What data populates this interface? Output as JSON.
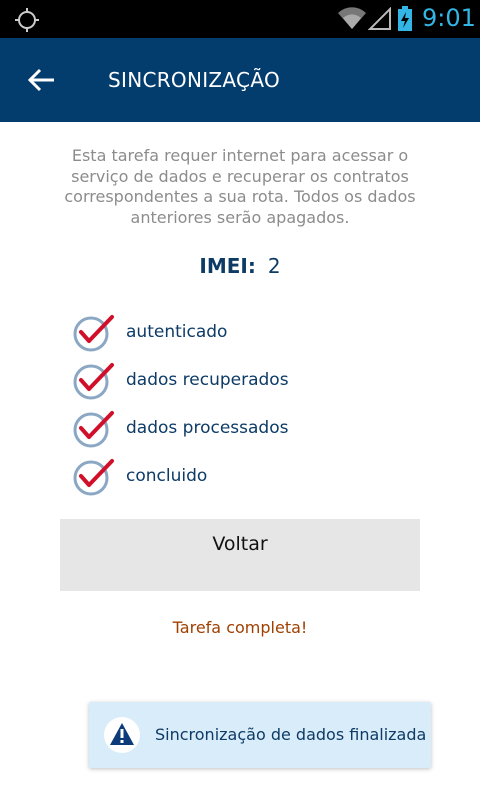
{
  "status_bar": {
    "time": "9:01",
    "icons": [
      "gps-icon",
      "wifi-icon",
      "signal-icon",
      "battery-charging-icon"
    ],
    "color": "#33b5e5"
  },
  "header": {
    "title": "SINCRONIZAÇÃO",
    "back_icon": "arrow-left-icon",
    "background": "#033d6e"
  },
  "description": "Esta tarefa requer internet para acessar o serviço de dados e recuperar os contratos correspondentes a sua rota. Todos os dados anteriores serão apagados.",
  "imei": {
    "label": "IMEI:",
    "value": "2"
  },
  "steps": [
    {
      "label": "autenticado",
      "icon": "check-circle-icon",
      "done": true
    },
    {
      "label": "dados recuperados",
      "icon": "check-circle-icon",
      "done": true
    },
    {
      "label": "dados processados",
      "icon": "check-circle-icon",
      "done": true
    },
    {
      "label": "concluido",
      "icon": "check-circle-icon",
      "done": true
    }
  ],
  "back_button_label": "Voltar",
  "task_status": "Tarefa completa!",
  "toast": {
    "message": "Sincronização de dados finalizada",
    "icon": "warning-icon"
  },
  "colors": {
    "accent": "#0d3b66",
    "check": "#d0102a",
    "status_text": "#a04000",
    "toast_bg": "#d9ecf9"
  }
}
